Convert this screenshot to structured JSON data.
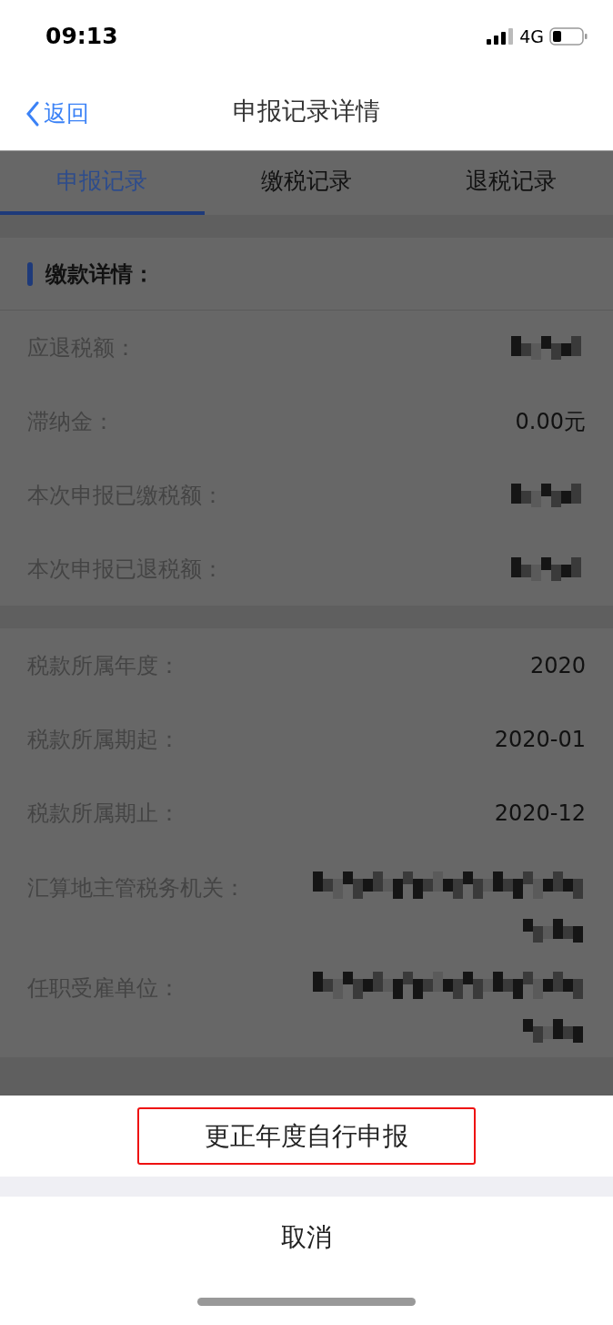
{
  "status_bar": {
    "time": "09:13",
    "network": "4G"
  },
  "nav": {
    "back": "返回",
    "title": "申报记录详情"
  },
  "tabs": [
    {
      "label": "申报记录",
      "selected": true
    },
    {
      "label": "缴税记录",
      "selected": false
    },
    {
      "label": "退税记录",
      "selected": false
    }
  ],
  "sections": [
    {
      "title": "缴款详情：",
      "rows": [
        {
          "label": "应退税额：",
          "kind": "redacted_short"
        },
        {
          "label": "滞纳金：",
          "kind": "text",
          "value": "0.00元"
        },
        {
          "label": "本次申报已缴税额：",
          "kind": "redacted_short"
        },
        {
          "label": "本次申报已退税额：",
          "kind": "redacted_short"
        }
      ]
    },
    {
      "rows": [
        {
          "label": "税款所属年度：",
          "kind": "text",
          "value": "2020"
        },
        {
          "label": "税款所属期起：",
          "kind": "text",
          "value": "2020-01"
        },
        {
          "label": "税款所属期止：",
          "kind": "text",
          "value": "2020-12"
        },
        {
          "label": "汇算地主管税务机关：",
          "kind": "redacted_long"
        },
        {
          "label": "任职受雇单位：",
          "kind": "redacted_long"
        }
      ]
    }
  ],
  "action_sheet": {
    "actions": [
      {
        "label": "更正年度自行申报",
        "highlighted": true
      }
    ],
    "cancel": "取消"
  }
}
